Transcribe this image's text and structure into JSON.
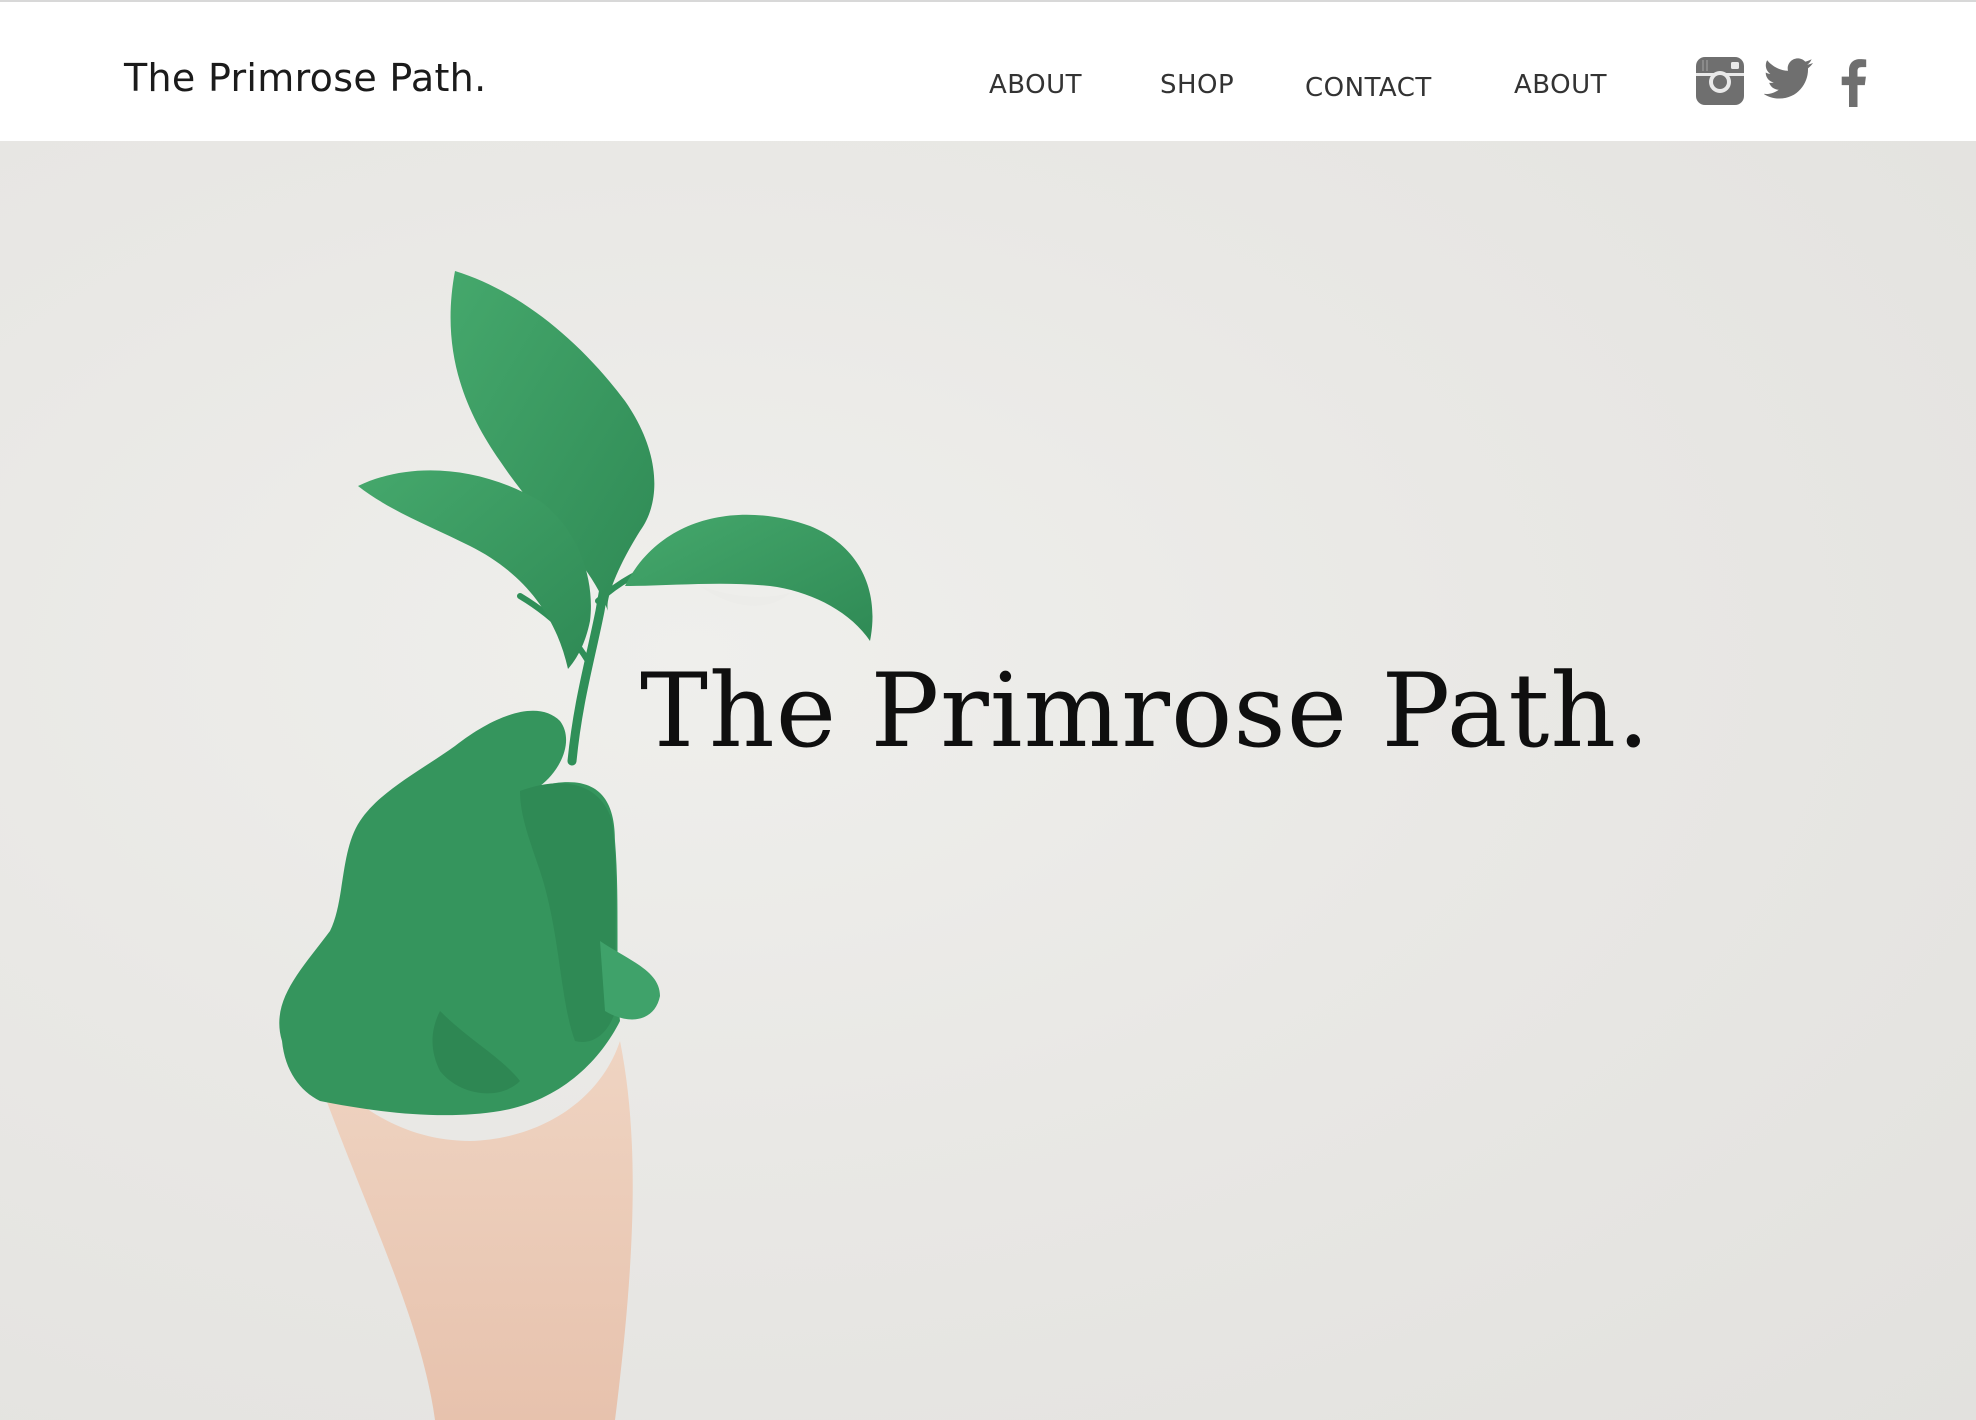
{
  "header": {
    "brand": "The Primrose Path.",
    "nav": [
      {
        "label": "ABOUT"
      },
      {
        "label": "SHOP"
      },
      {
        "label": "CONTACT"
      },
      {
        "label": "ABOUT"
      }
    ],
    "social": [
      {
        "icon": "instagram-icon"
      },
      {
        "icon": "twitter-icon"
      },
      {
        "icon": "facebook-icon"
      }
    ]
  },
  "hero": {
    "title": "The Primrose Path."
  },
  "colors": {
    "icon_gray": "#6f6f6f",
    "leaf_green": "#3a9a62",
    "background": "#e7e6e3"
  }
}
